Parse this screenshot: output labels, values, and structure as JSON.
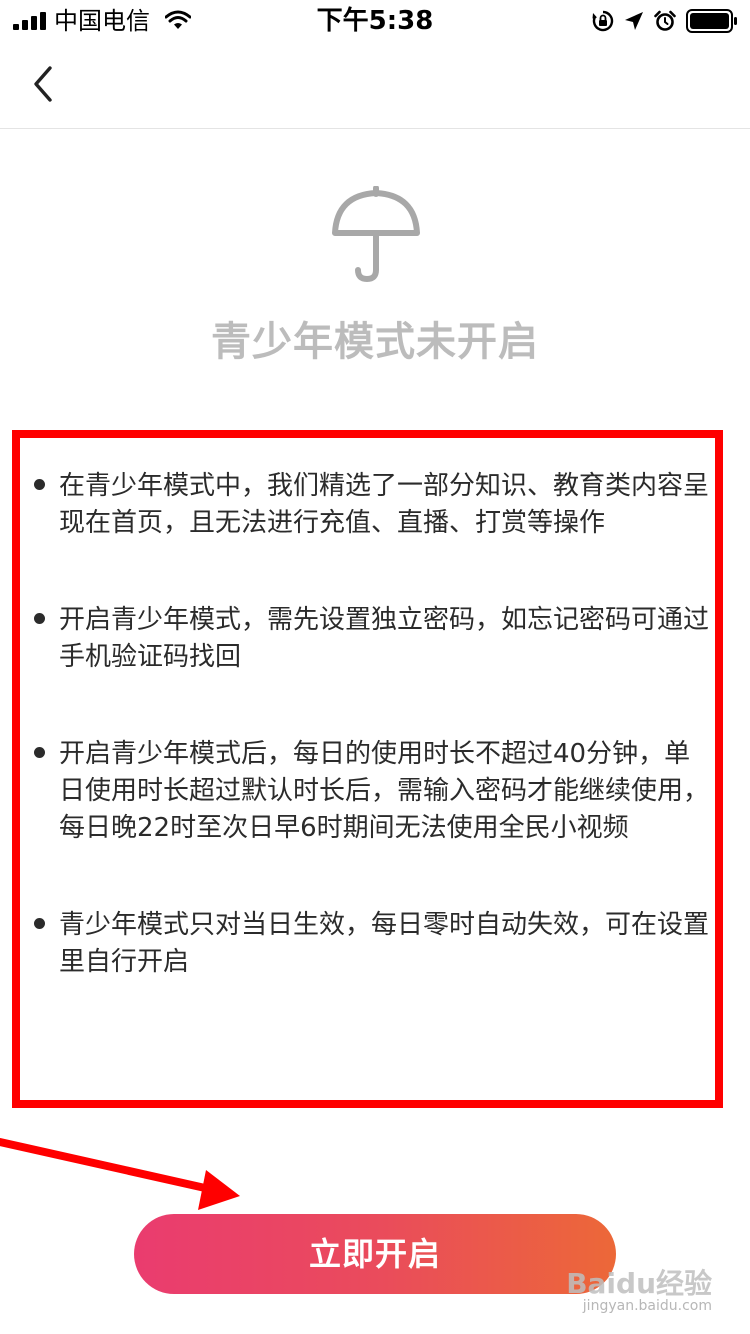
{
  "status_bar": {
    "carrier": "中国电信",
    "time": "下午5:38",
    "icons": [
      "signal-icon",
      "wifi-icon",
      "orientation-lock-icon",
      "location-icon",
      "alarm-icon",
      "battery-icon"
    ]
  },
  "nav": {
    "back_icon": "chevron-left-icon"
  },
  "hero": {
    "icon": "umbrella-icon",
    "status_text": "青少年模式未开启"
  },
  "rules": [
    {
      "text": "在青少年模式中，我们精选了一部分知识、教育类内容呈现在首页，且无法进行充值、直播、打赏等操作"
    },
    {
      "text": "开启青少年模式，需先设置独立密码，如忘记密码可通过手机验证码找回"
    },
    {
      "text": "开启青少年模式后，每日的使用时长不超过40分钟，单日使用时长超过默认时长后，需输入密码才能继续使用，每日晚22时至次日早6时期间无法使用全民小视频"
    },
    {
      "text": "青少年模式只对当日生效，每日零时自动失效，可在设置里自行开启"
    }
  ],
  "actions": {
    "enable_label": "立即开启"
  },
  "watermark": {
    "brand": "Baidu经验",
    "url": "jingyan.baidu.com"
  },
  "colors": {
    "annotation_red": "#ff0000",
    "button_gradient_start": "#ea3c6f",
    "button_gradient_end": "#ec6838",
    "muted_gray": "#bcbcbc"
  }
}
